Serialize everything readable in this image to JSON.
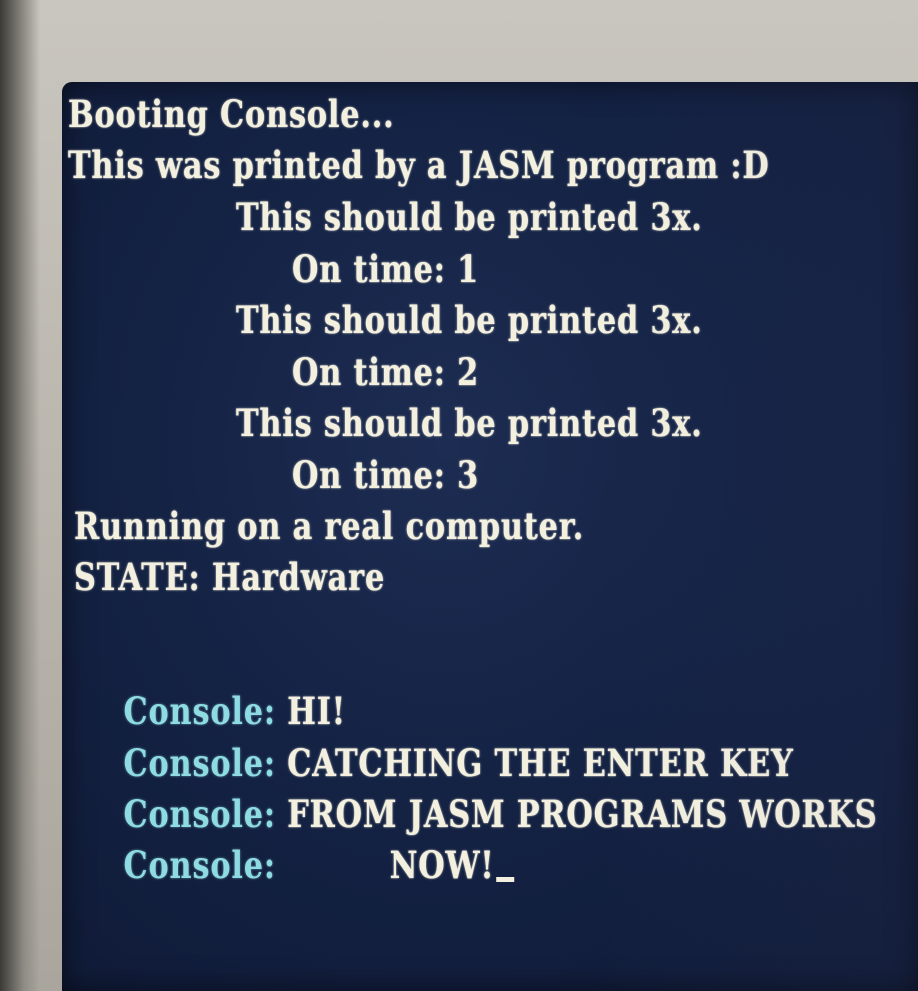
{
  "console": {
    "lines": [
      "Booting Console...",
      "This was printed by a JASM program :D",
      "This should be printed 3x.",
      "On time: 1",
      "This should be printed 3x.",
      "On time: 2",
      "This should be printed 3x.",
      "On time: 3",
      "Running on a real computer.",
      "STATE: Hardware"
    ],
    "prefix": "Console:",
    "messages": [
      "HI!",
      "CATCHING THE ENTER KEY",
      "FROM JASM PROGRAMS WORKS",
      "NOW!"
    ]
  },
  "colors": {
    "screen_bg": "#142244",
    "text": "#f3f0df",
    "prefix_text": "#8fdbe2",
    "bezel": "#c9c6bf"
  }
}
